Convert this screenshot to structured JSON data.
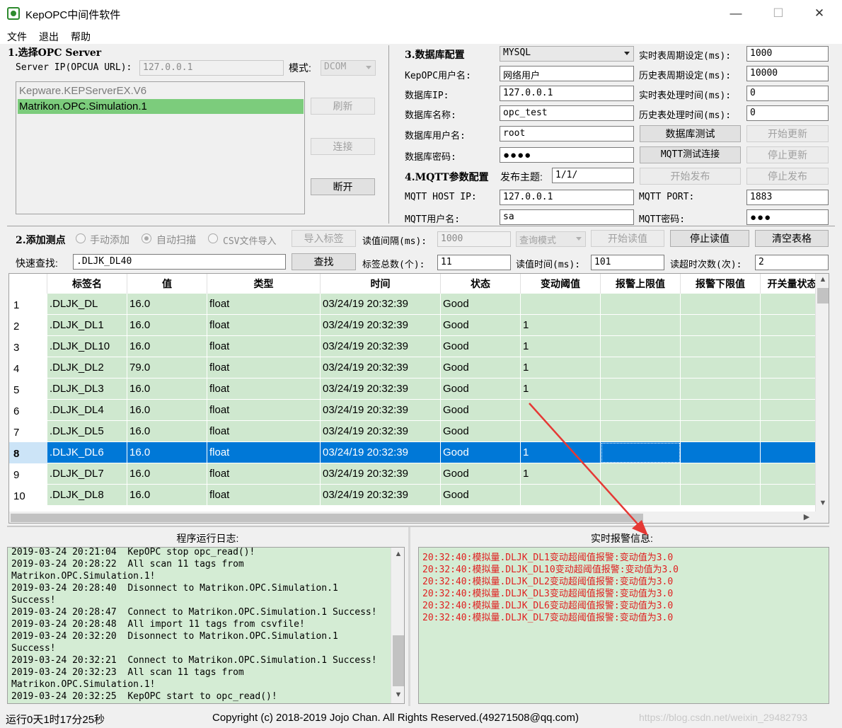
{
  "window": {
    "title": "KepOPC中间件软件",
    "minimize": "—",
    "maximize": "☐",
    "close": "✕"
  },
  "menu": [
    "文件",
    "退出",
    "帮助"
  ],
  "opc": {
    "section_title": "1.选择OPC Server",
    "server_ip_label": "Server IP(OPCUA URL):",
    "server_ip_value": "127.0.0.1",
    "mode_label": "模式:",
    "mode_value": "DCOM",
    "servers": [
      "Kepware.KEPServerEX.V6",
      "Matrikon.OPC.Simulation.1"
    ],
    "selected_server_index": 1,
    "refresh_btn": "刷新",
    "connect_btn": "连接",
    "disconnect_btn": "断开"
  },
  "db": {
    "section_title": "3.数据库配置",
    "db_type": "MYSQL",
    "user_label": "KepOPC用户名:",
    "user_value": "网络用户",
    "ip_label": "数据库IP:",
    "ip_value": "127.0.0.1",
    "name_label": "数据库名称:",
    "name_value": "opc_test",
    "db_user_label": "数据库用户名:",
    "db_user_value": "root",
    "db_pwd_label": "数据库密码:",
    "db_pwd_value": "●●●●",
    "rt_period_label": "实时表周期设定(ms):",
    "rt_period_value": "1000",
    "hist_period_label": "历史表周期设定(ms):",
    "hist_period_value": "10000",
    "rt_proc_label": "实时表处理时间(ms):",
    "rt_proc_value": "0",
    "hist_proc_label": "历史表处理时间(ms):",
    "hist_proc_value": "0",
    "db_test_btn": "数据库测试",
    "start_update_btn": "开始更新",
    "mqtt_test_btn": "MQTT测试连接",
    "stop_update_btn": "停止更新"
  },
  "mqtt": {
    "section_title": "4.MQTT参数配置",
    "topic_label": "发布主题:",
    "topic_value": "1/1/",
    "start_publish_btn": "开始发布",
    "stop_publish_btn": "停止发布",
    "host_label": "MQTT HOST IP:",
    "host_value": "127.0.0.1",
    "port_label": "MQTT PORT:",
    "port_value": "1883",
    "user_label": "MQTT用户名:",
    "user_value": "sa",
    "pwd_label": "MQTT密码:",
    "pwd_value": "●●●"
  },
  "tags": {
    "section_title": "2.添加测点",
    "manual_add": "手动添加",
    "auto_scan": "自动扫描",
    "csv_import": "CSV文件导入",
    "import_btn": "导入标签",
    "interval_label": "读值间隔(ms):",
    "interval_value": "1000",
    "query_mode": "查询模式",
    "start_read_btn": "开始读值",
    "stop_read_btn": "停止读值",
    "clear_btn": "清空表格",
    "quick_find_label": "快速查找:",
    "quick_find_value": ".DLJK_DL40",
    "find_btn": "查找",
    "total_label": "标签总数(个):",
    "total_value": "11",
    "read_time_label": "读值时间(ms):",
    "read_time_value": "101",
    "timeout_label": "读超时次数(次):",
    "timeout_value": "2"
  },
  "table": {
    "columns": [
      "标签名",
      "值",
      "类型",
      "时间",
      "状态",
      "变动阈值",
      "报警上限值",
      "报警下限值",
      "开关量状态"
    ],
    "selected_row": 7,
    "rows": [
      {
        "num": "1",
        "cells": [
          ".DLJK_DL",
          "16.0",
          "float",
          "03/24/19 20:32:39",
          "Good",
          "",
          "",
          "",
          ""
        ]
      },
      {
        "num": "2",
        "cells": [
          ".DLJK_DL1",
          "16.0",
          "float",
          "03/24/19 20:32:39",
          "Good",
          "1",
          "",
          "",
          ""
        ]
      },
      {
        "num": "3",
        "cells": [
          ".DLJK_DL10",
          "16.0",
          "float",
          "03/24/19 20:32:39",
          "Good",
          "1",
          "",
          "",
          ""
        ]
      },
      {
        "num": "4",
        "cells": [
          ".DLJK_DL2",
          "79.0",
          "float",
          "03/24/19 20:32:39",
          "Good",
          "1",
          "",
          "",
          ""
        ]
      },
      {
        "num": "5",
        "cells": [
          ".DLJK_DL3",
          "16.0",
          "float",
          "03/24/19 20:32:39",
          "Good",
          "1",
          "",
          "",
          ""
        ]
      },
      {
        "num": "6",
        "cells": [
          ".DLJK_DL4",
          "16.0",
          "float",
          "03/24/19 20:32:39",
          "Good",
          "",
          "",
          "",
          ""
        ]
      },
      {
        "num": "7",
        "cells": [
          ".DLJK_DL5",
          "16.0",
          "float",
          "03/24/19 20:32:39",
          "Good",
          "",
          "",
          "",
          ""
        ]
      },
      {
        "num": "8",
        "cells": [
          ".DLJK_DL6",
          "16.0",
          "float",
          "03/24/19 20:32:39",
          "Good",
          "1",
          "",
          "",
          ""
        ]
      },
      {
        "num": "9",
        "cells": [
          ".DLJK_DL7",
          "16.0",
          "float",
          "03/24/19 20:32:39",
          "Good",
          "1",
          "",
          "",
          ""
        ]
      },
      {
        "num": "10",
        "cells": [
          ".DLJK_DL8",
          "16.0",
          "float",
          "03/24/19 20:32:39",
          "Good",
          "",
          "",
          "",
          ""
        ]
      }
    ]
  },
  "log": {
    "title": "程序运行日志:",
    "lines": [
      "2019-03-24 20:21:04  KepOPC stop opc_read()!",
      "2019-03-24 20:28:22  All scan 11 tags from",
      "Matrikon.OPC.Simulation.1!",
      "2019-03-24 20:28:40  Disonnect to Matrikon.OPC.Simulation.1",
      "Success!",
      "2019-03-24 20:28:47  Connect to Matrikon.OPC.Simulation.1 Success!",
      "2019-03-24 20:28:48  All import 11 tags from csvfile!",
      "2019-03-24 20:32:20  Disonnect to Matrikon.OPC.Simulation.1",
      "Success!",
      "2019-03-24 20:32:21  Connect to Matrikon.OPC.Simulation.1 Success!",
      "2019-03-24 20:32:23  All scan 11 tags from",
      "Matrikon.OPC.Simulation.1!",
      "2019-03-24 20:32:25  KepOPC start to opc_read()!"
    ]
  },
  "alarm": {
    "title": "实时报警信息:",
    "lines": [
      "20:32:40:模拟量.DLJK_DL1变动超阈值报警:变动值为3.0",
      "20:32:40:模拟量.DLJK_DL10变动超阈值报警:变动值为3.0",
      "20:32:40:模拟量.DLJK_DL2变动超阈值报警:变动值为3.0",
      "20:32:40:模拟量.DLJK_DL3变动超阈值报警:变动值为3.0",
      "20:32:40:模拟量.DLJK_DL6变动超阈值报警:变动值为3.0",
      "20:32:40:模拟量.DLJK_DL7变动超阈值报警:变动值为3.0"
    ]
  },
  "status": {
    "runtime": "运行0天1时17分25秒",
    "copyright": "Copyright (c) 2018-2019 Jojo Chan. All Rights Reserved.(49271508@qq.com)",
    "watermark": "https://blog.csdn.net/weixin_29482793"
  },
  "colors": {
    "grid_green": "#cfe8cf",
    "selection_blue": "#0078d7",
    "alarm_red": "#e02020",
    "annotation_arrow": "#e53935"
  }
}
